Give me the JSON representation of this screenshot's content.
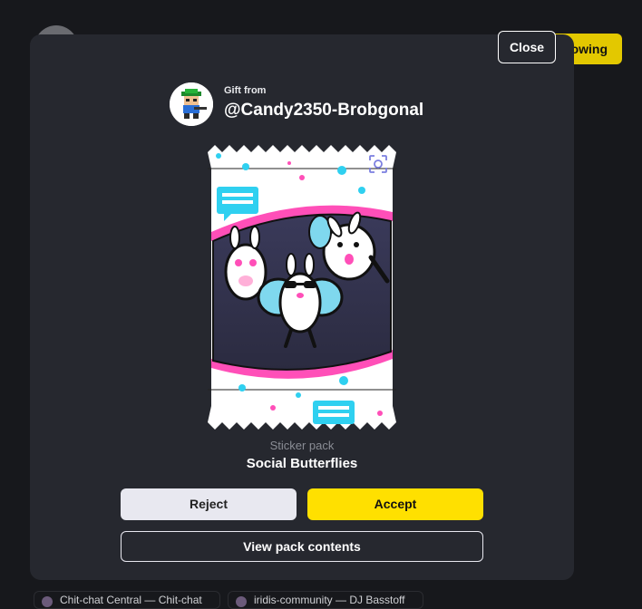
{
  "background": {
    "follow_label": "owing",
    "chips": [
      "Chit-chat Central — Chit-chat",
      "iridis-community — DJ Basstoff"
    ]
  },
  "modal": {
    "close_label": "Close",
    "gift_from_label": "Gift from",
    "username": "@Candy2350-Brobgonal",
    "pack_type": "Sticker pack",
    "pack_name": "Social Butterflies",
    "reject_label": "Reject",
    "accept_label": "Accept",
    "view_label": "View pack contents"
  },
  "colors": {
    "accent": "#ffe000",
    "modal_bg": "#26282f",
    "page_bg": "#17181c",
    "pack_pink": "#ff4fb8",
    "pack_cyan": "#2fd0f0"
  },
  "icons": [
    "user-avatar-icon",
    "scan-icon",
    "chat-bubble-icon"
  ]
}
